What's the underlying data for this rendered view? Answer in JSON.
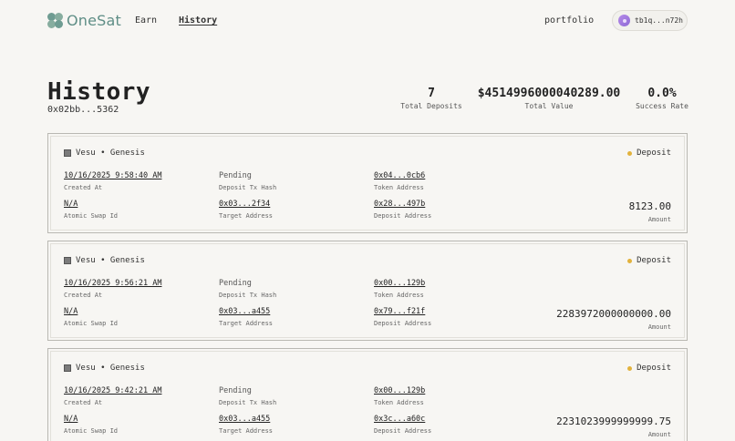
{
  "nav": {
    "logo": "OneSat",
    "links": [
      "Earn",
      "History"
    ],
    "portfolio": "portfolio",
    "wallet": "tb1q...n72h"
  },
  "header": {
    "title": "History",
    "address": "0x02bb...5362",
    "stats": [
      {
        "value": "7",
        "label": "Total Deposits"
      },
      {
        "value": "$4514996000040289.00",
        "label": "Total Value"
      },
      {
        "value": "0.0%",
        "label": "Success Rate"
      }
    ]
  },
  "labels": {
    "created_at": "Created At",
    "deposit_tx_hash": "Deposit Tx Hash",
    "token_address": "Token Address",
    "atomic_swap_id": "Atomic Swap Id",
    "target_address": "Target Address",
    "deposit_address": "Deposit Address",
    "amount": "Amount"
  },
  "cards": [
    {
      "protocol": "Vesu • Genesis",
      "type": "Deposit",
      "created_at": "10/16/2025 9:58:40 AM",
      "deposit_tx_hash": "Pending",
      "token_address": "0x04...0cb6",
      "atomic_swap_id": "N/A",
      "target_address": "0x03...2f34",
      "deposit_address": "0x28...497b",
      "amount": "8123.00"
    },
    {
      "protocol": "Vesu • Genesis",
      "type": "Deposit",
      "created_at": "10/16/2025 9:56:21 AM",
      "deposit_tx_hash": "Pending",
      "token_address": "0x00...129b",
      "atomic_swap_id": "N/A",
      "target_address": "0x03...a455",
      "deposit_address": "0x79...f21f",
      "amount": "2283972000000000.00"
    },
    {
      "protocol": "Vesu • Genesis",
      "type": "Deposit",
      "created_at": "10/16/2025 9:42:21 AM",
      "deposit_tx_hash": "Pending",
      "token_address": "0x00...129b",
      "atomic_swap_id": "N/A",
      "target_address": "0x03...a455",
      "deposit_address": "0x3c...a60c",
      "amount": "2231023999999999.75"
    }
  ],
  "colors": {
    "background": "#f7f6f3",
    "brand": "#5f8e86",
    "status_dot": "#e2b23c"
  }
}
